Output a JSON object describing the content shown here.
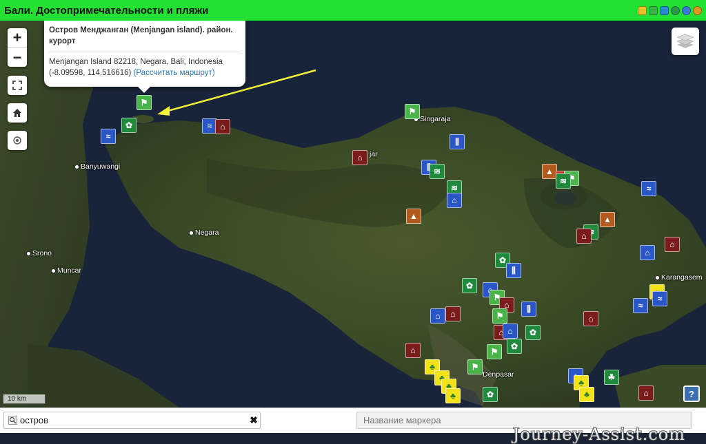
{
  "app": {
    "title": "Бали. Достопримечательности и пляжи",
    "toolbar_icons": [
      "edit-icon",
      "fullscreen-icon",
      "share-icon",
      "globe-icon",
      "link-icon",
      "info-icon"
    ]
  },
  "map": {
    "zoom_in": "+",
    "zoom_out": "−",
    "popup": {
      "title": "Остров Менджанган (Menjangan island). район. курорт",
      "address": "Menjangan Island 82218, Negara, Bali, Indonesia",
      "coords": "(-8.09598, 114.516616)",
      "route_link": "(Рассчитать маршрут)"
    },
    "place_labels": {
      "banyuwangi": "Banyuwangi",
      "negara": "Negara",
      "srono": "Srono",
      "muncar": "Muncar",
      "singaraja": "Singaraja",
      "karangasem": "Karangasem",
      "denpasar": "Denpasar",
      "seririt": "jar"
    },
    "scale": "10 km",
    "help": "?",
    "watermark": "Journey-Assist.com",
    "colors": {
      "marker_green": "#4ab34a",
      "marker_darkgreen": "#1f8a3c",
      "marker_blue": "#2a56c8",
      "marker_maroon": "#7a1c1c",
      "marker_brown": "#b35a1f",
      "marker_yellow": "#f2e21a",
      "arrow": "#f5f23a"
    }
  },
  "bottom": {
    "search_value": "остров",
    "search_clear": "✖",
    "marker_name_placeholder": "Название маркера"
  }
}
